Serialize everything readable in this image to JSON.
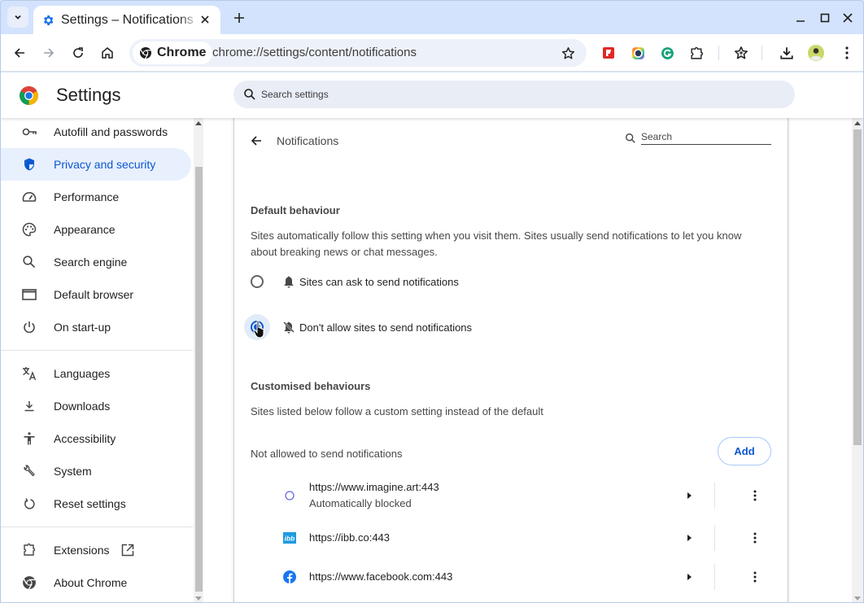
{
  "browser": {
    "tab": {
      "title": "Settings – Notifications",
      "icon": "gear-icon"
    },
    "new_tab_label": "+",
    "omnibox": {
      "chip_label": "Chrome",
      "url": "chrome://settings/content/notifications"
    },
    "extensions": [
      "flipboard-icon",
      "camera-lens-icon",
      "grammarly-icon",
      "puzzle-extensions-icon"
    ]
  },
  "settings": {
    "title": "Settings",
    "search_placeholder": "Search settings"
  },
  "sidebar": {
    "items": [
      {
        "label": "Autofill and passwords",
        "icon": "key-icon"
      },
      {
        "label": "Privacy and security",
        "icon": "shield-icon",
        "active": true
      },
      {
        "label": "Performance",
        "icon": "speedometer-icon"
      },
      {
        "label": "Appearance",
        "icon": "palette-icon"
      },
      {
        "label": "Search engine",
        "icon": "search-icon"
      },
      {
        "label": "Default browser",
        "icon": "browser-window-icon"
      },
      {
        "label": "On start-up",
        "icon": "power-icon"
      },
      {
        "label": "Languages",
        "icon": "translate-icon"
      },
      {
        "label": "Downloads",
        "icon": "download-icon"
      },
      {
        "label": "Accessibility",
        "icon": "accessibility-icon"
      },
      {
        "label": "System",
        "icon": "wrench-icon"
      },
      {
        "label": "Reset settings",
        "icon": "reset-icon"
      },
      {
        "label": "Extensions",
        "icon": "puzzle-icon"
      },
      {
        "label": "About Chrome",
        "icon": "chrome-icon"
      }
    ]
  },
  "page": {
    "title": "Notifications",
    "search_placeholder": "Search",
    "default_behaviour": {
      "heading": "Default behaviour",
      "description": "Sites automatically follow this setting when you visit them. Sites usually send notifications to let you know about breaking news or chat messages.",
      "options": [
        {
          "label": "Sites can ask to send notifications",
          "icon": "bell-icon",
          "checked": false
        },
        {
          "label": "Don't allow sites to send notifications",
          "icon": "bell-off-icon",
          "checked": true
        }
      ]
    },
    "customised": {
      "heading": "Customised behaviours",
      "description": "Sites listed below follow a custom setting instead of the default",
      "list_title": "Not allowed to send notifications",
      "add_label": "Add",
      "sites": [
        {
          "url": "https://www.imagine.art:443",
          "sub": "Automatically blocked",
          "icon": "imagine-art-favicon"
        },
        {
          "url": "https://ibb.co:443",
          "sub": "",
          "icon": "ibb-favicon",
          "icon_text": "ibb"
        },
        {
          "url": "https://www.facebook.com:443",
          "sub": "",
          "icon": "facebook-favicon"
        }
      ]
    }
  },
  "colors": {
    "accent": "#0b57d0",
    "active_nav_bg": "#e8f0fe",
    "frame": "#d3e3fd"
  }
}
